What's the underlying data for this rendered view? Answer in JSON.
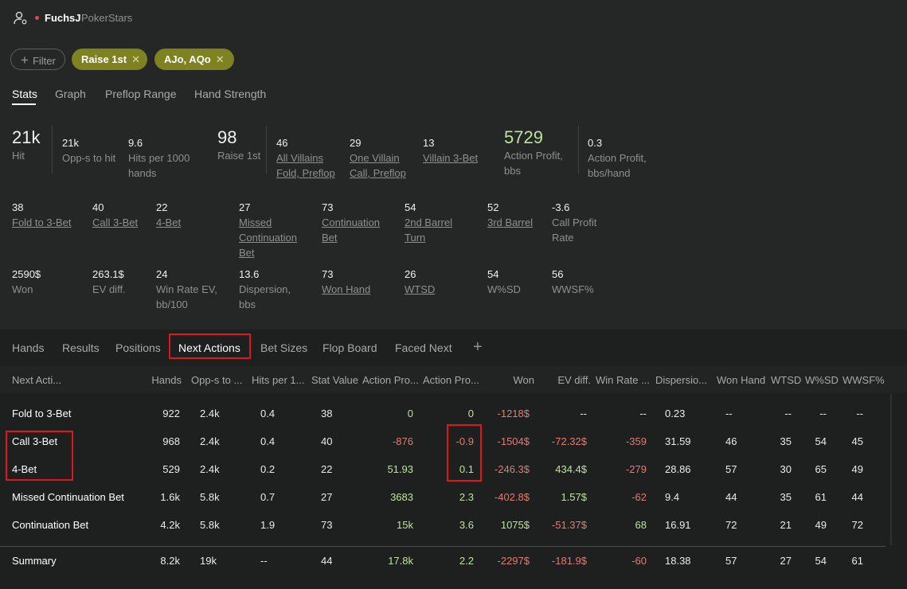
{
  "header": {
    "username": "FuchsJ",
    "site": "PokerStars"
  },
  "filters": {
    "filter_label": "Filter",
    "chips": [
      {
        "label": "Raise 1st"
      },
      {
        "label": "AJo, AQo"
      }
    ]
  },
  "tabs": [
    "Stats",
    "Graph",
    "Preflop Range",
    "Hand Strength"
  ],
  "stats_row1": [
    {
      "value": "21k",
      "label": "Hit"
    },
    {
      "value": "21k",
      "label": "Opp-s to hit"
    },
    {
      "value": "9.6",
      "label": "Hits per 1000 hands"
    },
    {
      "value": "98",
      "label": "Raise 1st"
    },
    {
      "value": "46",
      "label": "All Villains Fold, Preflop"
    },
    {
      "value": "29",
      "label": "One Villain Call, Preflop"
    },
    {
      "value": "13",
      "label": "Villain 3-Bet"
    },
    {
      "value": "5729",
      "label": "Action Profit, bbs"
    },
    {
      "value": "0.3",
      "label": "Action Profit, bbs/hand"
    }
  ],
  "stats_row2": [
    {
      "value": "38",
      "label": "Fold to 3-Bet"
    },
    {
      "value": "40",
      "label": "Call 3-Bet"
    },
    {
      "value": "22",
      "label": "4-Bet"
    },
    {
      "value": "27",
      "label": "Missed Continuation Bet"
    },
    {
      "value": "73",
      "label": "Continuation Bet"
    },
    {
      "value": "54",
      "label": "2nd Barrel Turn"
    },
    {
      "value": "52",
      "label": "3rd Barrel"
    },
    {
      "value": "-3.6",
      "label": "Call Profit Rate"
    }
  ],
  "stats_row3": [
    {
      "value": "2590$",
      "label": "Won"
    },
    {
      "value": "263.1$",
      "label": "EV diff."
    },
    {
      "value": "24",
      "label": "Win Rate EV, bb/100"
    },
    {
      "value": "13.6",
      "label": "Dispersion, bbs"
    },
    {
      "value": "73",
      "label": "Won Hand"
    },
    {
      "value": "26",
      "label": "WTSD"
    },
    {
      "value": "54",
      "label": "W%SD"
    },
    {
      "value": "56",
      "label": "WWSF%"
    }
  ],
  "bottom_tabs": [
    "Hands",
    "Results",
    "Positions",
    "Next Actions",
    "Bet Sizes",
    "Flop Board",
    "Faced Next"
  ],
  "table": {
    "columns": [
      "Next Acti...",
      "Hands",
      "Opp-s to ...",
      "Hits per 1...",
      "Stat Value",
      "Action Pro...",
      "Action Pro...",
      "Won",
      "EV diff.",
      "Win Rate ...",
      "Dispersio...",
      "Won Hand",
      "WTSD",
      "W%SD",
      "WWSF%"
    ],
    "rows": [
      [
        "Fold to 3-Bet",
        "922",
        "2.4k",
        "0.4",
        "38",
        "0",
        "0",
        "-1218$",
        "--",
        "--",
        "0.23",
        "--",
        "--",
        "--",
        "--"
      ],
      [
        "Call 3-Bet",
        "968",
        "2.4k",
        "0.4",
        "40",
        "-876",
        "-0.9",
        "-1504$",
        "-72.32$",
        "-359",
        "31.59",
        "46",
        "35",
        "54",
        "45"
      ],
      [
        "4-Bet",
        "529",
        "2.4k",
        "0.2",
        "22",
        "51.93",
        "0.1",
        "-246.3$",
        "434.4$",
        "-279",
        "28.86",
        "57",
        "30",
        "65",
        "49"
      ],
      [
        "Missed Continuation Bet",
        "1.6k",
        "5.8k",
        "0.7",
        "27",
        "3683",
        "2.3",
        "-402.8$",
        "1.57$",
        "-62",
        "9.4",
        "44",
        "35",
        "61",
        "44"
      ],
      [
        "Continuation Bet",
        "4.2k",
        "5.8k",
        "1.9",
        "73",
        "15k",
        "3.6",
        "1075$",
        "-51.37$",
        "68",
        "16.91",
        "72",
        "21",
        "49",
        "72"
      ]
    ],
    "summary": [
      "Summary",
      "8.2k",
      "19k",
      "--",
      "44",
      "17.8k",
      "2.2",
      "-2297$",
      "-181.9$",
      "-60",
      "18.38",
      "57",
      "27",
      "54",
      "61"
    ]
  },
  "colors": {
    "positive": "#b9e49a",
    "negative": "#e37b72",
    "chip": "#7e8221",
    "highlight": "#e1161b"
  }
}
